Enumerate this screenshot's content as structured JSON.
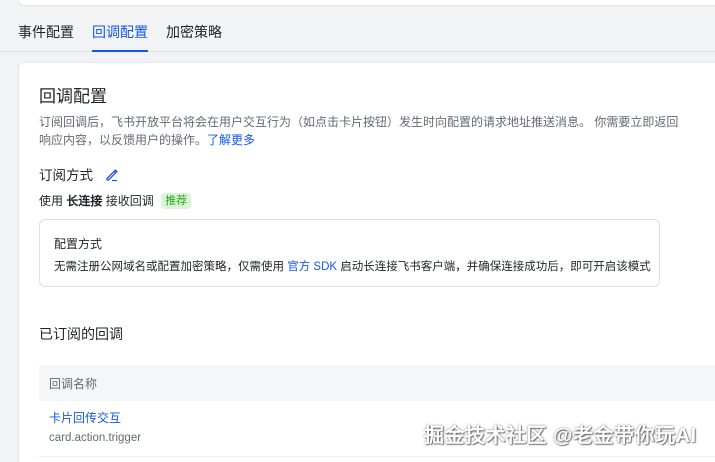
{
  "tabs": [
    {
      "label": "事件配置"
    },
    {
      "label": "回调配置"
    },
    {
      "label": "加密策略"
    }
  ],
  "main": {
    "title": "回调配置",
    "desc_text": "订阅回调后，飞书开放平台将会在用户交互行为（如点击卡片按钮）发生时向配置的请求地址推送消息。 你需要立即返回响应内容，以反馈用户的操作。",
    "learn_more": "了解更多",
    "subscription_label": "订阅方式",
    "usage_prefix": "使用",
    "usage_mode": "长连接",
    "usage_suffix": "接收回调",
    "recommend_badge": "推荐",
    "config_box": {
      "title": "配置方式",
      "desc_prefix": "无需注册公网域名或配置加密策略，仅需使用",
      "sdk_link": "官方 SDK",
      "desc_suffix": "启动长连接飞书客户端，并确保连接成功后，即可开启该模式"
    },
    "subscribed_title": "已订阅的回调",
    "table": {
      "header": "回调名称",
      "rows": [
        {
          "name": "卡片回传交互",
          "event": "card.action.trigger"
        }
      ]
    }
  },
  "watermark": "掘金技术社区 @老金带你玩AI",
  "colors": {
    "accent": "#1456f0",
    "badge_bg": "#d9f5d6",
    "badge_fg": "#2ea121"
  }
}
